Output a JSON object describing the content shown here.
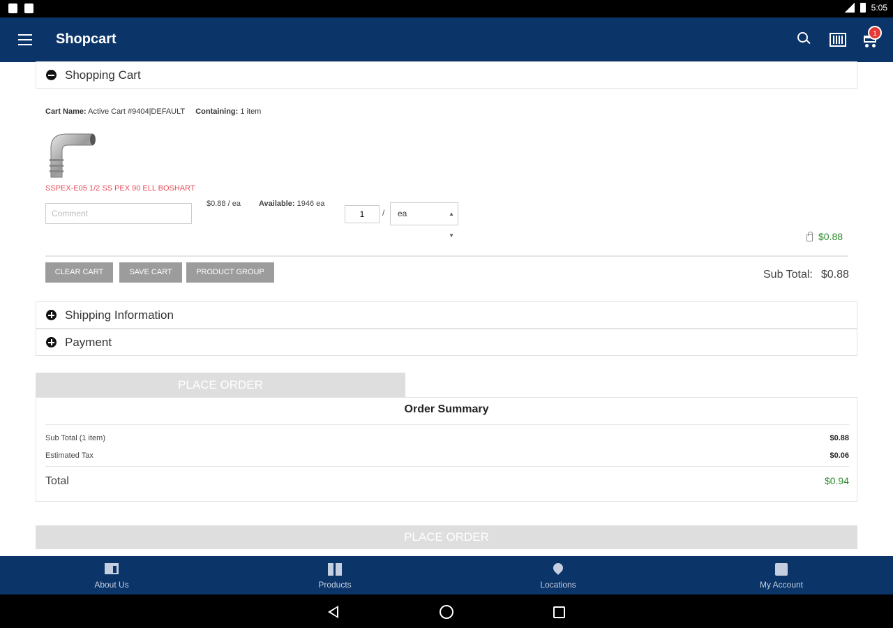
{
  "status_bar": {
    "time": "5:05"
  },
  "app_bar": {
    "title": "Shopcart",
    "cart_count": "1"
  },
  "shopping_cart": {
    "header": "Shopping Cart",
    "cart_name_label": "Cart Name:",
    "cart_name_value": "Active Cart #9404|DEFAULT",
    "containing_label": "Containing:",
    "containing_value": "1 item",
    "item": {
      "name": "SSPEX-E05 1/2 SS PEX 90 ELL BOSHART",
      "comment_placeholder": "Comment",
      "price_each": "$0.88 / ea",
      "available_label": "Available:",
      "available_value": "1946 ea",
      "quantity": "1",
      "uom": "ea",
      "line_total": "$0.88"
    },
    "buttons": {
      "clear": "CLEAR CART",
      "save": "SAVE CART",
      "product_group": "PRODUCT GROUP"
    },
    "sub_total_label": "Sub Total:",
    "sub_total_value": "$0.88"
  },
  "sections": {
    "shipping": "Shipping Information",
    "payment": "Payment"
  },
  "place_order_label": "PLACE ORDER",
  "order_summary": {
    "title": "Order Summary",
    "rows": [
      {
        "label": "Sub Total (1 item)",
        "value": "$0.88"
      },
      {
        "label": "Estimated Tax",
        "value": "$0.06"
      }
    ],
    "total_label": "Total",
    "total_value": "$0.94"
  },
  "bottom_nav": [
    {
      "label": "About Us",
      "icon": "business-icon"
    },
    {
      "label": "Products",
      "icon": "dashboard-icon"
    },
    {
      "label": "Locations",
      "icon": "location-pin-icon"
    },
    {
      "label": "My Account",
      "icon": "account-box-icon"
    }
  ],
  "colors": {
    "brand": "#0b3468",
    "price_green": "#2e8b2e",
    "product_link": "#e84e5a",
    "badge": "#e53935"
  }
}
